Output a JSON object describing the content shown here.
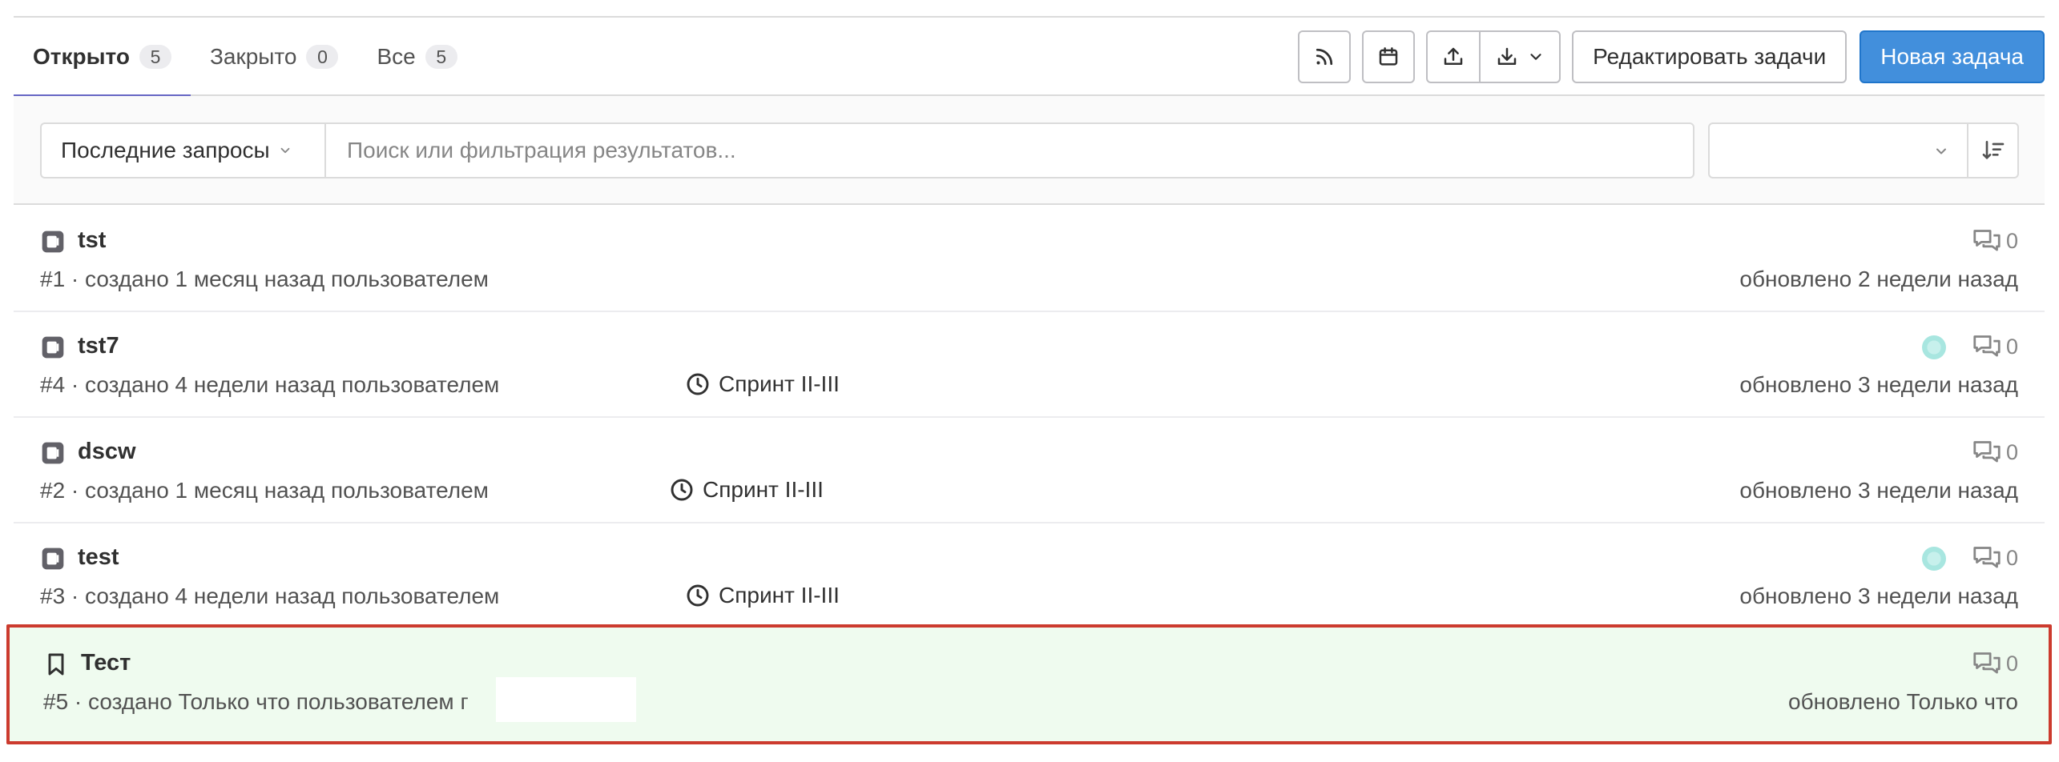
{
  "tabs": [
    {
      "label": "Открыто",
      "count": "5"
    },
    {
      "label": "Закрыто",
      "count": "0"
    },
    {
      "label": "Все",
      "count": "5"
    }
  ],
  "toolbar": {
    "rss_icon": "rss-icon",
    "calendar_icon": "calendar-icon",
    "import_icon": "upload-icon",
    "export_icon": "download-icon",
    "bulk_edit_label": "Редактировать задачи",
    "new_issue_label": "Новая задача"
  },
  "filter": {
    "recent_label": "Последние запросы",
    "search_placeholder": "Поиск или фильтрация результатов...",
    "sort_value": ""
  },
  "issues": [
    {
      "title": "tst",
      "meta": "#1 · создано 1 месяц назад пользователем",
      "milestone": "",
      "comments": "0",
      "updated": "обновлено 2 недели назад",
      "has_avatar": false
    },
    {
      "title": "tst7",
      "meta": "#4 · создано 4 недели назад пользователем",
      "milestone": "Спринт II-III",
      "comments": "0",
      "updated": "обновлено 3 недели назад",
      "has_avatar": true
    },
    {
      "title": "dscw",
      "meta": "#2 · создано 1 месяц назад пользователем",
      "milestone": "Спринт II-III",
      "comments": "0",
      "updated": "обновлено 3 недели назад",
      "has_avatar": false
    },
    {
      "title": "test",
      "meta": "#3 · создано 4 недели назад пользователем",
      "milestone": "Спринт II-III",
      "comments": "0",
      "updated": "обновлено 3 недели назад",
      "has_avatar": true
    },
    {
      "title": "Тест",
      "meta": "#5 · создано Только что пользователем г",
      "milestone": "",
      "comments": "0",
      "updated": "обновлено Только что",
      "has_avatar": false
    }
  ],
  "colors": {
    "active_tab_underline": "#6666c4",
    "primary_button": "#428fdc",
    "highlight_row_bg": "#effbef",
    "highlight_row_border": "#cc3b2e"
  }
}
